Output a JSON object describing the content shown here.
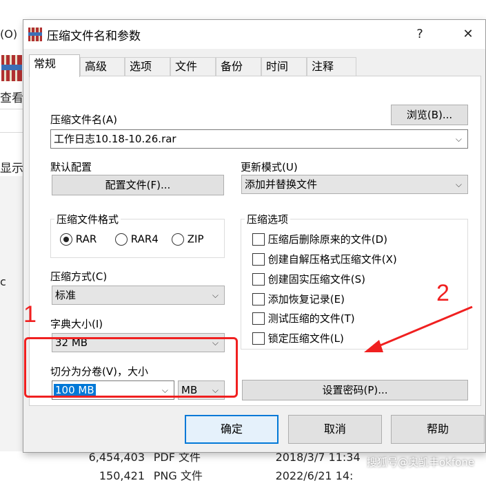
{
  "background": {
    "menu_fragment": "(O)",
    "view_label": "查看",
    "display_label": "显示",
    "trailing_char": "c",
    "rows": [
      {
        "size": "6,454,403",
        "type": "PDF 文件",
        "date": "2018/3/7 11:34"
      },
      {
        "size": "150,421",
        "type": "PNG 文件",
        "date": "2022/6/21 14:"
      }
    ]
  },
  "dialog": {
    "title": "压缩文件名和参数",
    "help_btn": "?",
    "close_btn": "✕",
    "tabs": [
      "常规",
      "高级",
      "选项",
      "文件",
      "备份",
      "时间",
      "注释"
    ],
    "archive_name_label": "压缩文件名(A)",
    "browse_btn": "浏览(B)...",
    "archive_name_value": "工作日志10.18-10.26.rar",
    "default_profile_label": "默认配置",
    "profile_btn": "配置文件(F)...",
    "update_mode_label": "更新模式(U)",
    "update_mode_value": "添加并替换文件",
    "format_group_title": "压缩文件格式",
    "formats": [
      {
        "label": "RAR",
        "selected": true
      },
      {
        "label": "RAR4",
        "selected": false
      },
      {
        "label": "ZIP",
        "selected": false
      }
    ],
    "method_label": "压缩方式(C)",
    "method_value": "标准",
    "dict_label": "字典大小(I)",
    "dict_value": "32 MB",
    "split_label": "切分为分卷(V)，大小",
    "split_value": "100 MB",
    "split_unit": "MB",
    "options_group_title": "压缩选项",
    "options": [
      {
        "label": "压缩后删除原来的文件(D)",
        "checked": false
      },
      {
        "label": "创建自解压格式压缩文件(X)",
        "checked": false
      },
      {
        "label": "创建固实压缩文件(S)",
        "checked": false
      },
      {
        "label": "添加恢复记录(E)",
        "checked": false
      },
      {
        "label": "测试压缩的文件(T)",
        "checked": false
      },
      {
        "label": "锁定压缩文件(L)",
        "checked": false
      }
    ],
    "password_btn": "设置密码(P)...",
    "ok_btn": "确定",
    "cancel_btn": "取消",
    "help_footer_btn": "帮助"
  },
  "annotations": {
    "marker_1": "1",
    "marker_2": "2",
    "color": "#f02020"
  },
  "watermark": "搜狐号@奥凯丰okfone"
}
